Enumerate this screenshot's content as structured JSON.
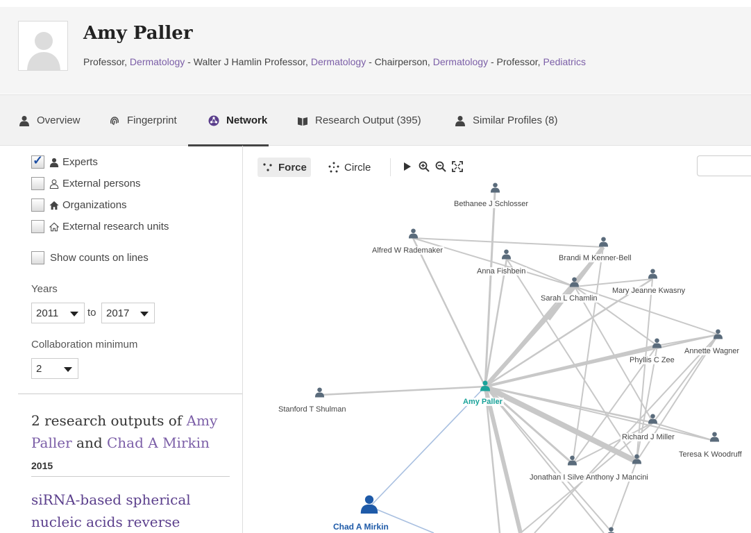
{
  "profile": {
    "name": "Amy Paller",
    "titles": [
      {
        "role": "Professor, ",
        "dept": "Dermatology",
        "sep": " - "
      },
      {
        "role": "Walter J Hamlin Professor, ",
        "dept": "Dermatology",
        "sep": " - "
      },
      {
        "role": "Chairperson, ",
        "dept": "Dermatology",
        "sep": " - "
      },
      {
        "role": "Professor, ",
        "dept": "Pediatrics",
        "sep": ""
      }
    ]
  },
  "tabs": {
    "overview": "Overview",
    "fingerprint": "Fingerprint",
    "network": "Network",
    "research_output": "Research Output (395)",
    "similar_profiles": "Similar Profiles (8)"
  },
  "filters": {
    "experts": "Experts",
    "external_persons": "External persons",
    "organizations": "Organizations",
    "external_units": "External research units",
    "show_counts": "Show counts on lines",
    "experts_checked": true
  },
  "years": {
    "label": "Years",
    "from": "2011",
    "between": "to",
    "to": "2017"
  },
  "collaboration": {
    "label": "Collaboration minimum",
    "value": "2"
  },
  "outputs": {
    "count_text": "2 research outputs of ",
    "person_a": "Amy Paller",
    "and_text": " and ",
    "person_b": "Chad A Mirkin",
    "year": "2015",
    "paper_title": "siRNA-based spherical nucleic acids reverse"
  },
  "graph": {
    "force_label": "Force",
    "circle_label": "Circle",
    "nodes": {
      "amy": "Amy Paller",
      "chad": "Chad A Mirkin",
      "bethanee": "Bethanee J Schlosser",
      "alfred": "Alfred W Rademaker",
      "anna": "Anna Fishbein",
      "brandi": "Brandi M Kenner-Bell",
      "mary": "Mary Jeanne Kwasny",
      "sarah": "Sarah L Chamlin",
      "phyllis": "Phyllis C Zee",
      "annette": "Annette Wagner",
      "stanford": "Stanford T Shulman",
      "richard": "Richard J Miller",
      "teresa": "Teresa K Woodruff",
      "jonathan": "Jonathan I Silverberg",
      "anthony": "Anthony J Mancini"
    }
  },
  "colors": {
    "link": "#7b5ea7",
    "teal": "#1aa39a",
    "node": "#5a6b7b",
    "chad": "#1e5aa8",
    "edge": "#c8c8c8",
    "edge_blue": "#a8bfe0"
  }
}
